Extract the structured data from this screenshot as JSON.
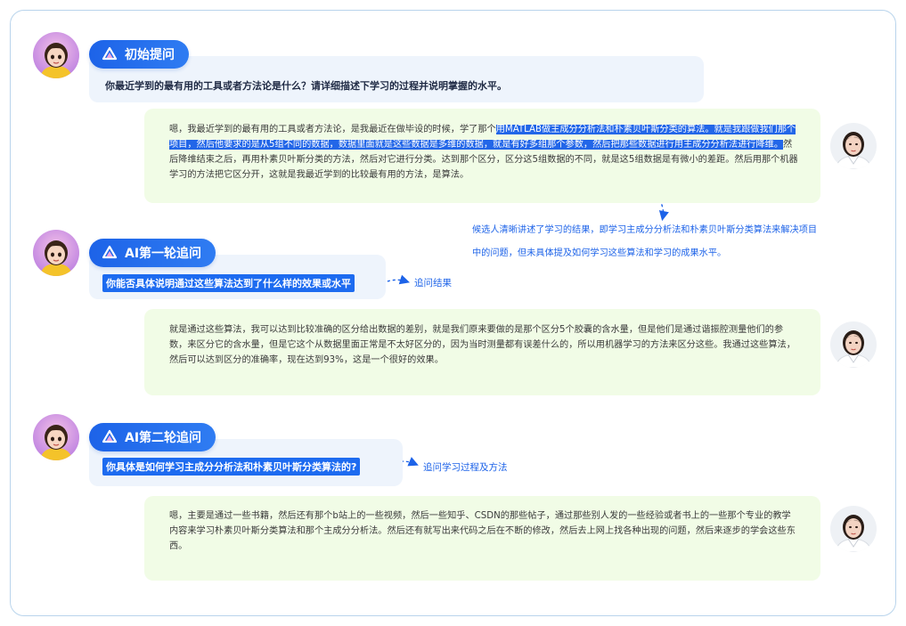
{
  "sections": [
    {
      "tag": "初始提问",
      "question": "你最近学到的最有用的工具或者方法论是什么？请详细描述下学习的过程并说明掌握的水平。",
      "answer_pre": "嗯，我最近学到的最有用的工具或者方法论，是我最近在做毕设的时候，学了那个",
      "answer_sel": "用MATLAB做主成分分析法和朴素贝叶斯分类的算法。就是我跟做我们那个项目，然后他要求的是从5组不同的数据，数据里面就是这些数据是多维的数据，就是有好多组那个参数，然后把那些数据进行用主成分分析法进行降维。",
      "answer_post": "然后降维结束之后，再用朴素贝叶斯分类的方法，然后对它进行分类。达到那个区分，区分这5组数据的不同，就是这5组数据是有微小的差距。然后用那个机器学习的方法把它区分开，这就是我最近学到的比较最有用的方法，是算法。"
    },
    {
      "tag": "AI第一轮追问",
      "question": "你能否具体说明通过这些算法达到了什么样的效果或水平",
      "arrow_label": "追问结果",
      "answer": "就是通过这些算法，我可以达到比较准确的区分给出数据的差别，就是我们原来要做的是那个区分5个胶囊的含水量，但是他们是通过谐振腔测量他们的参数，来区分它的含水量，但是它这个从数据里面正常是不太好区分的，因为当时测量都有误差什么的，所以用机器学习的方法来区分这些。我通过这些算法，然后可以达到区分的准确率，现在达到93%，这是一个很好的效果。"
    },
    {
      "tag": "AI第二轮追问",
      "question": "你具体是如何学习主成分分析法和朴素贝叶斯分类算法的?",
      "arrow_label": "追问学习过程及方法",
      "answer": "嗯，主要是通过一些书籍，然后还有那个b站上的一些视频，然后一些知乎、CSDN的那些帖子，通过那些别人发的一些经验或者书上的一些那个专业的教学内容来学习朴素贝叶斯分类算法和那个主成分分析法。然后还有就写出来代码之后在不断的修改，然后去上网上找各种出现的问题，然后来逐步的学会这些东西。"
    }
  ],
  "note": "候选人清晰讲述了学习的结果，即学习主成分分析法和朴素贝叶斯分类算法来解决项目中的问题，但未具体提及如何学习这些算法和学习的成果水平。",
  "colors": {
    "accent": "#1d63e8",
    "question_bg": "#eef4fc",
    "answer_bg": "#f1fce6",
    "frame": "#b9d4ec"
  },
  "icons": {
    "tag_icon": "ai-logo-icon",
    "interviewer": "ai-avatar-icon",
    "candidate": "candidate-avatar-icon"
  }
}
